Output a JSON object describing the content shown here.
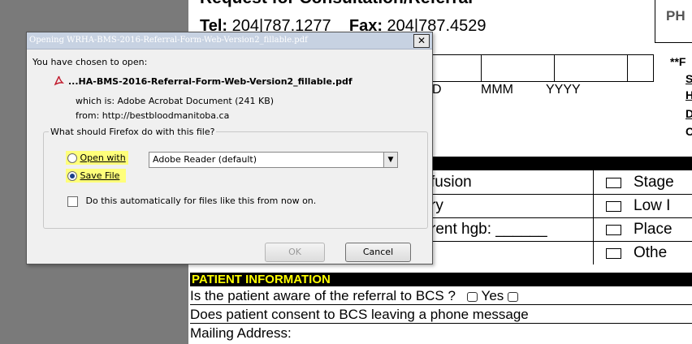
{
  "document": {
    "header_partial": "Request for Consultation/Referral",
    "tel_label": "Tel:",
    "tel": "204|787.1277",
    "fax_label": "Fax:",
    "fax": "204|787.4529",
    "ph_label": "PH",
    "date_labels": [
      "D",
      "MMM",
      "YYYY"
    ],
    "right_prefix": "**F",
    "right_letters": [
      "S",
      "H",
      "D",
      "C"
    ],
    "rows_left": [
      "fusion",
      "ry",
      "rent hgb: ______",
      ""
    ],
    "rows_right": [
      "Stage",
      "Low I",
      "Place",
      "Othe"
    ],
    "patient_info_header": "PATIENT INFORMATION",
    "aware_question": "Is the patient aware of the referral to BCS ?",
    "yes_label": "Yes",
    "consent_question": "Does patient consent to BCS leaving a phone message",
    "mailing_label": "Mailing Address:"
  },
  "dialog": {
    "title": "Opening WRHA-BMS-2016-Referral-Form-Web-Version2_fillable.pdf",
    "close_label": "✕",
    "intro": "You have chosen to open:",
    "file_icon": "pdf-icon",
    "filename": "...HA-BMS-2016-Referral-Form-Web-Version2_fillable.pdf",
    "which_is": "which is: Adobe Acrobat Document (241 KB)",
    "from": "from: http://bestbloodmanitoba.ca",
    "question": "What should Firefox do with this file?",
    "open_with_label": "Open with",
    "open_with_value": "Adobe Reader  (default)",
    "save_file_label": "Save File",
    "auto_label": "Do this automatically for files like this from now on.",
    "ok_label": "OK",
    "cancel_label": "Cancel",
    "selected_option": "Save File",
    "highlight_color": "#ffff7a"
  }
}
